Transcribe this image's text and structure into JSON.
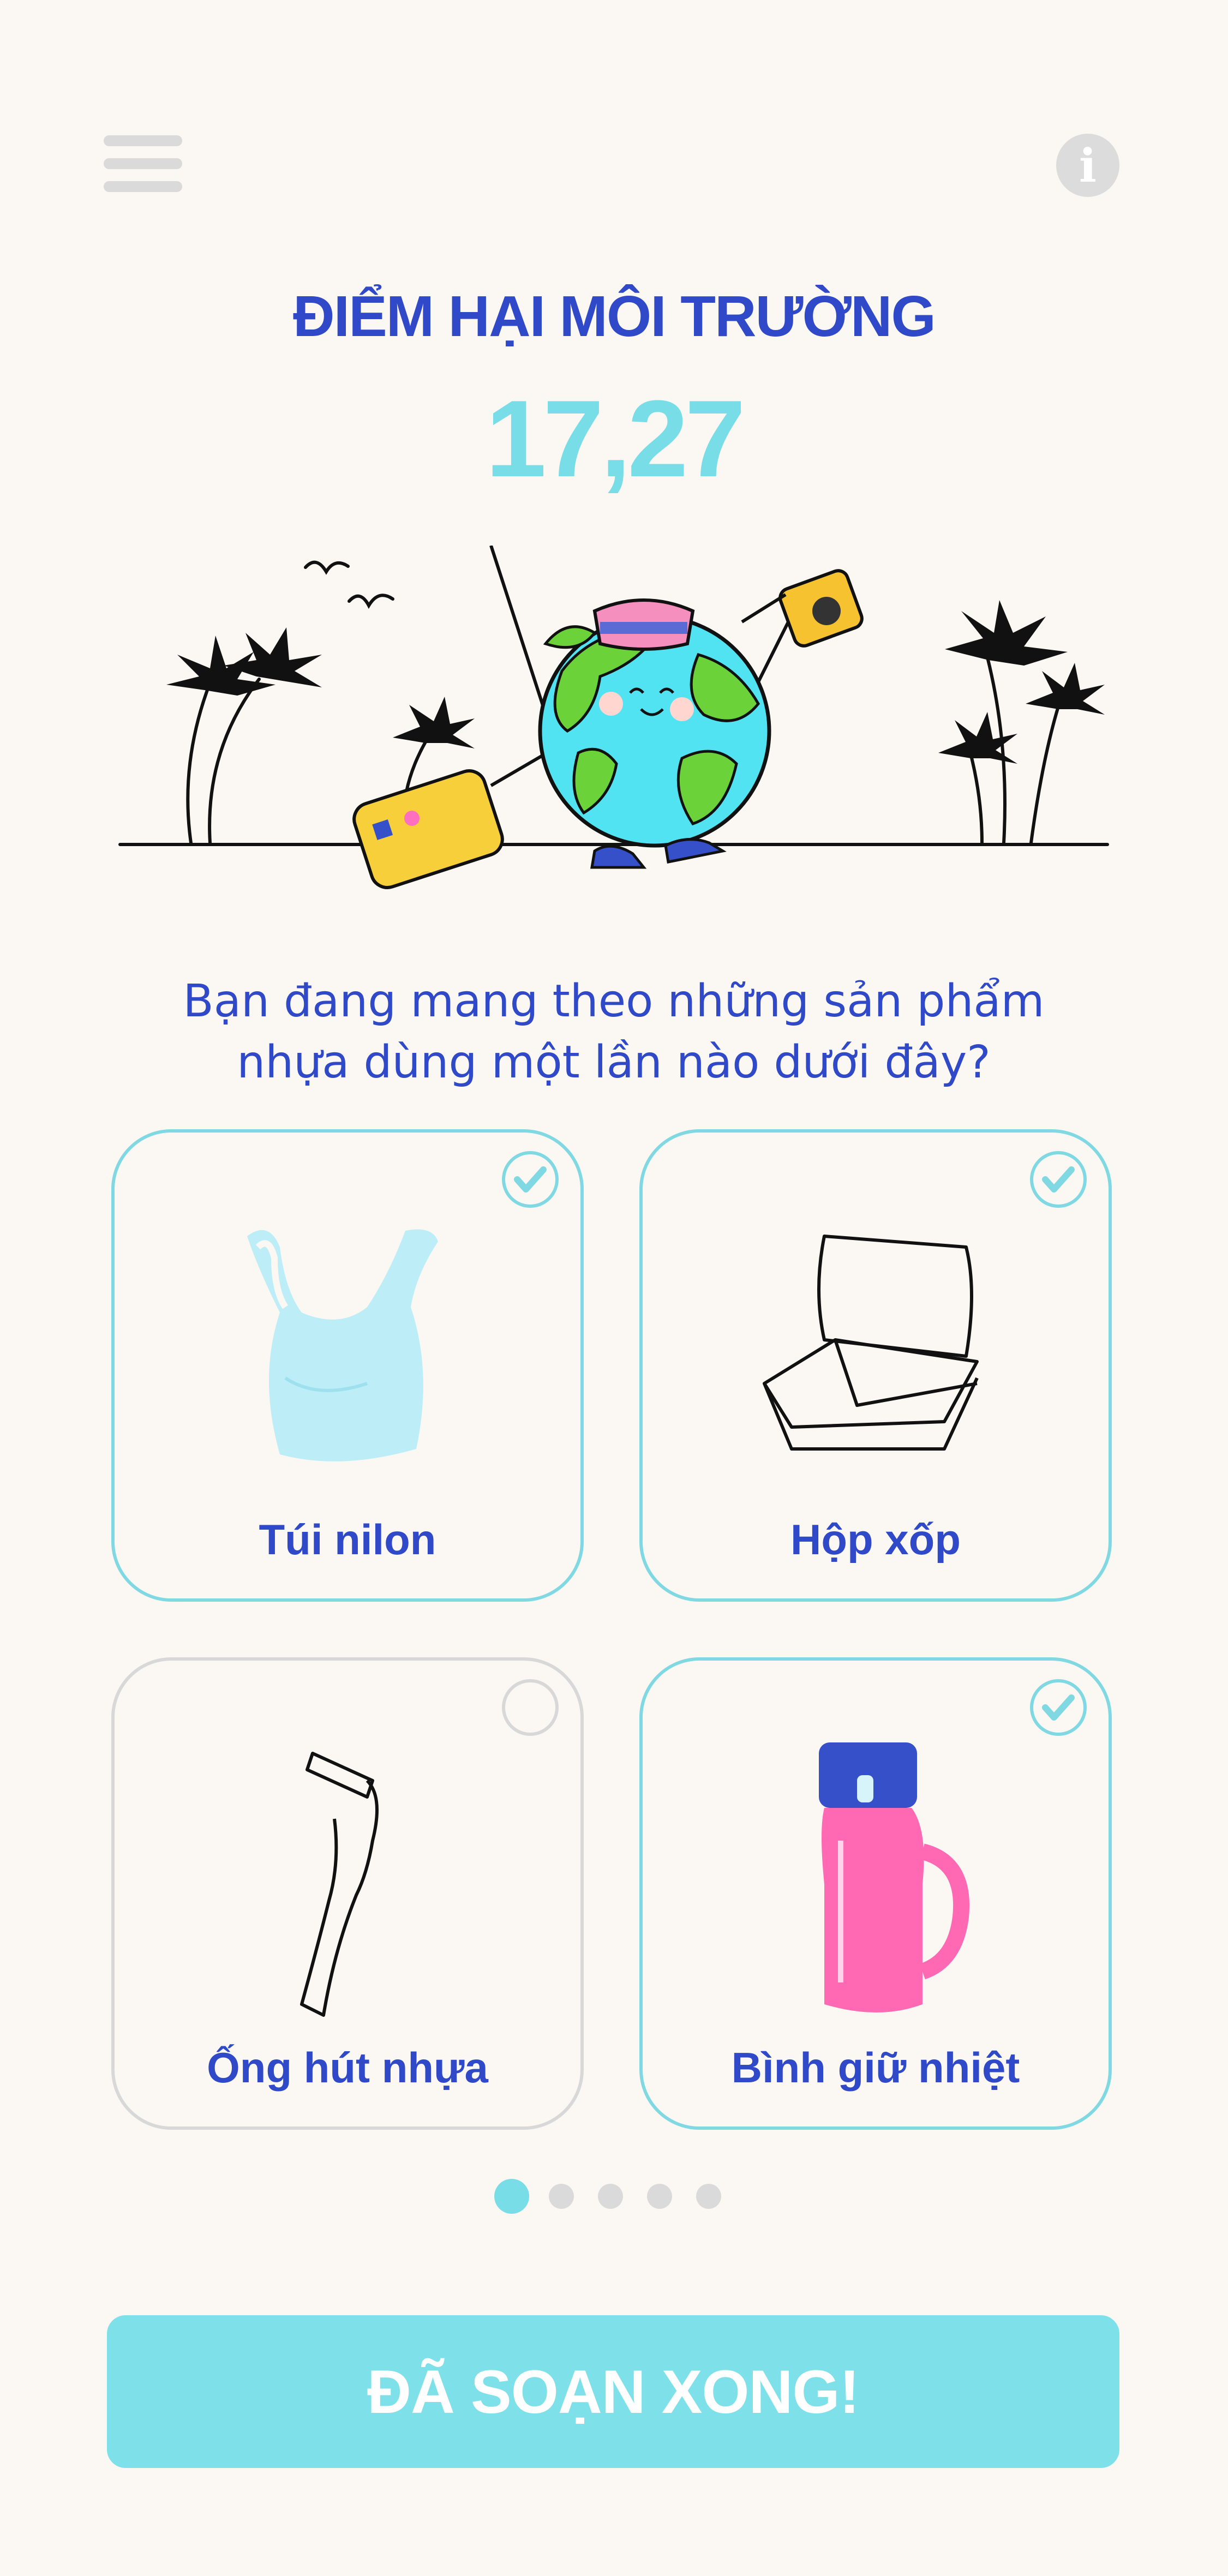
{
  "header": {
    "menu_icon": "hamburger-menu-icon",
    "info_icon": "info-icon",
    "info_glyph": "i"
  },
  "score": {
    "title": "ĐIỂM HẠI MÔI TRƯỜNG",
    "value": "17,27"
  },
  "question": {
    "line1": "Bạn đang mang theo những sản phẩm",
    "line2": "nhựa dùng một lần nào dưới đây?"
  },
  "items": [
    {
      "label": "Túi nilon",
      "selected": true,
      "icon": "plastic-bag-icon"
    },
    {
      "label": "Hộp xốp",
      "selected": true,
      "icon": "foam-box-icon"
    },
    {
      "label": "Ống hút nhựa",
      "selected": false,
      "icon": "plastic-straw-icon"
    },
    {
      "label": "Bình giữ nhiệt",
      "selected": true,
      "icon": "thermos-bottle-icon"
    }
  ],
  "pagination": {
    "current": 1,
    "total": 5
  },
  "done_button": {
    "label": "ĐÃ SOẠN XONG!"
  },
  "colors": {
    "primary": "#2f49c9",
    "accent": "#78dde6",
    "background": "#fbf8f3",
    "inactive": "#d8d8d8"
  }
}
